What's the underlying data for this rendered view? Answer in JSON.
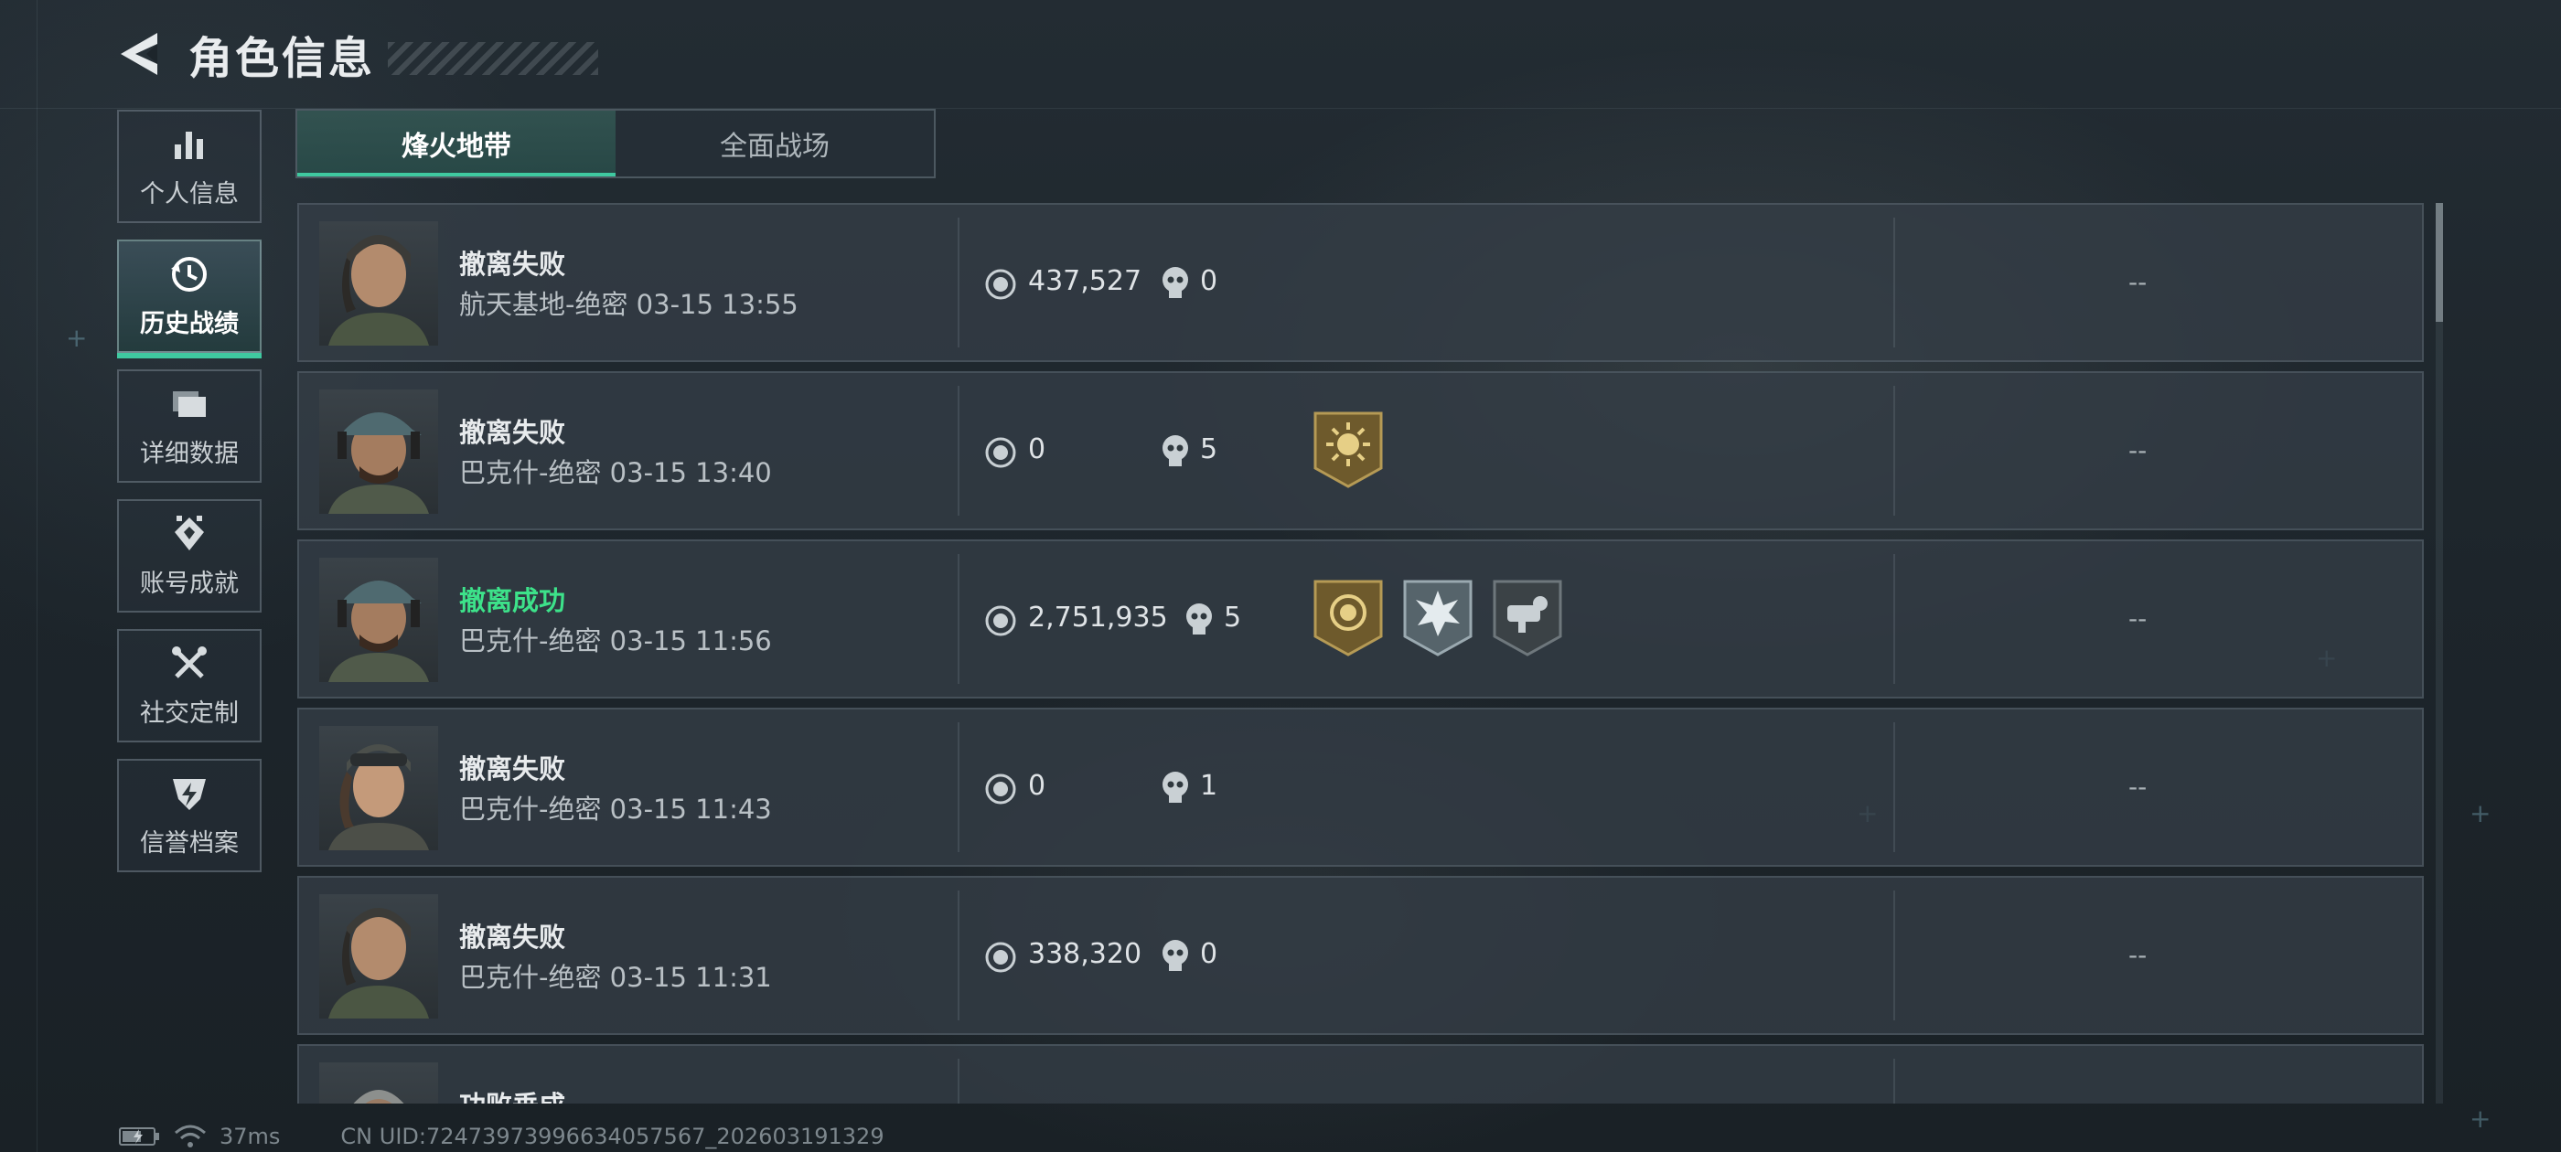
{
  "header": {
    "title": "角色信息"
  },
  "sidebar": {
    "items": [
      {
        "label": "个人信息",
        "icon": "bar-chart-icon",
        "active": false
      },
      {
        "label": "历史战绩",
        "icon": "history-clock-icon",
        "active": true
      },
      {
        "label": "详细数据",
        "icon": "folder-icon",
        "active": false
      },
      {
        "label": "账号成就",
        "icon": "achievement-icon",
        "active": false
      },
      {
        "label": "社交定制",
        "icon": "tools-icon",
        "active": false
      },
      {
        "label": "信誉档案",
        "icon": "credit-shield-icon",
        "active": false
      }
    ]
  },
  "tabs": [
    {
      "label": "烽火地带",
      "active": true
    },
    {
      "label": "全面战场",
      "active": false
    }
  ],
  "matches": [
    {
      "status": "撤离失败",
      "success": false,
      "map_time": "航天基地-绝密 03-15 13:55",
      "money": "437,527",
      "kills": "0",
      "badges": [],
      "extra": "--"
    },
    {
      "status": "撤离失败",
      "success": false,
      "map_time": "巴克什-绝密 03-15 13:40",
      "money": "0",
      "kills": "5",
      "badges": [
        "gold-sun-badge-icon"
      ],
      "extra": "--"
    },
    {
      "status": "撤离成功",
      "success": true,
      "map_time": "巴克什-绝密 03-15 11:56",
      "money": "2,751,935",
      "kills": "5",
      "badges": [
        "gold-coin-badge-icon",
        "silver-burst-badge-icon",
        "dark-gear-badge-icon"
      ],
      "extra": "--"
    },
    {
      "status": "撤离失败",
      "success": false,
      "map_time": "巴克什-绝密 03-15 11:43",
      "money": "0",
      "kills": "1",
      "badges": [],
      "extra": "--"
    },
    {
      "status": "撤离失败",
      "success": false,
      "map_time": "巴克什-绝密 03-15 11:31",
      "money": "338,320",
      "kills": "0",
      "badges": [],
      "extra": "--"
    },
    {
      "status": "功败垂成",
      "success": false,
      "map_time": "",
      "money": "",
      "kills": "",
      "badges": [],
      "extra": ""
    }
  ],
  "footer": {
    "ping": "37ms",
    "uid": "CN UID:72473973996634057567_202603191329"
  },
  "colors": {
    "accent": "#3fc9a0",
    "success": "#3de28a"
  }
}
